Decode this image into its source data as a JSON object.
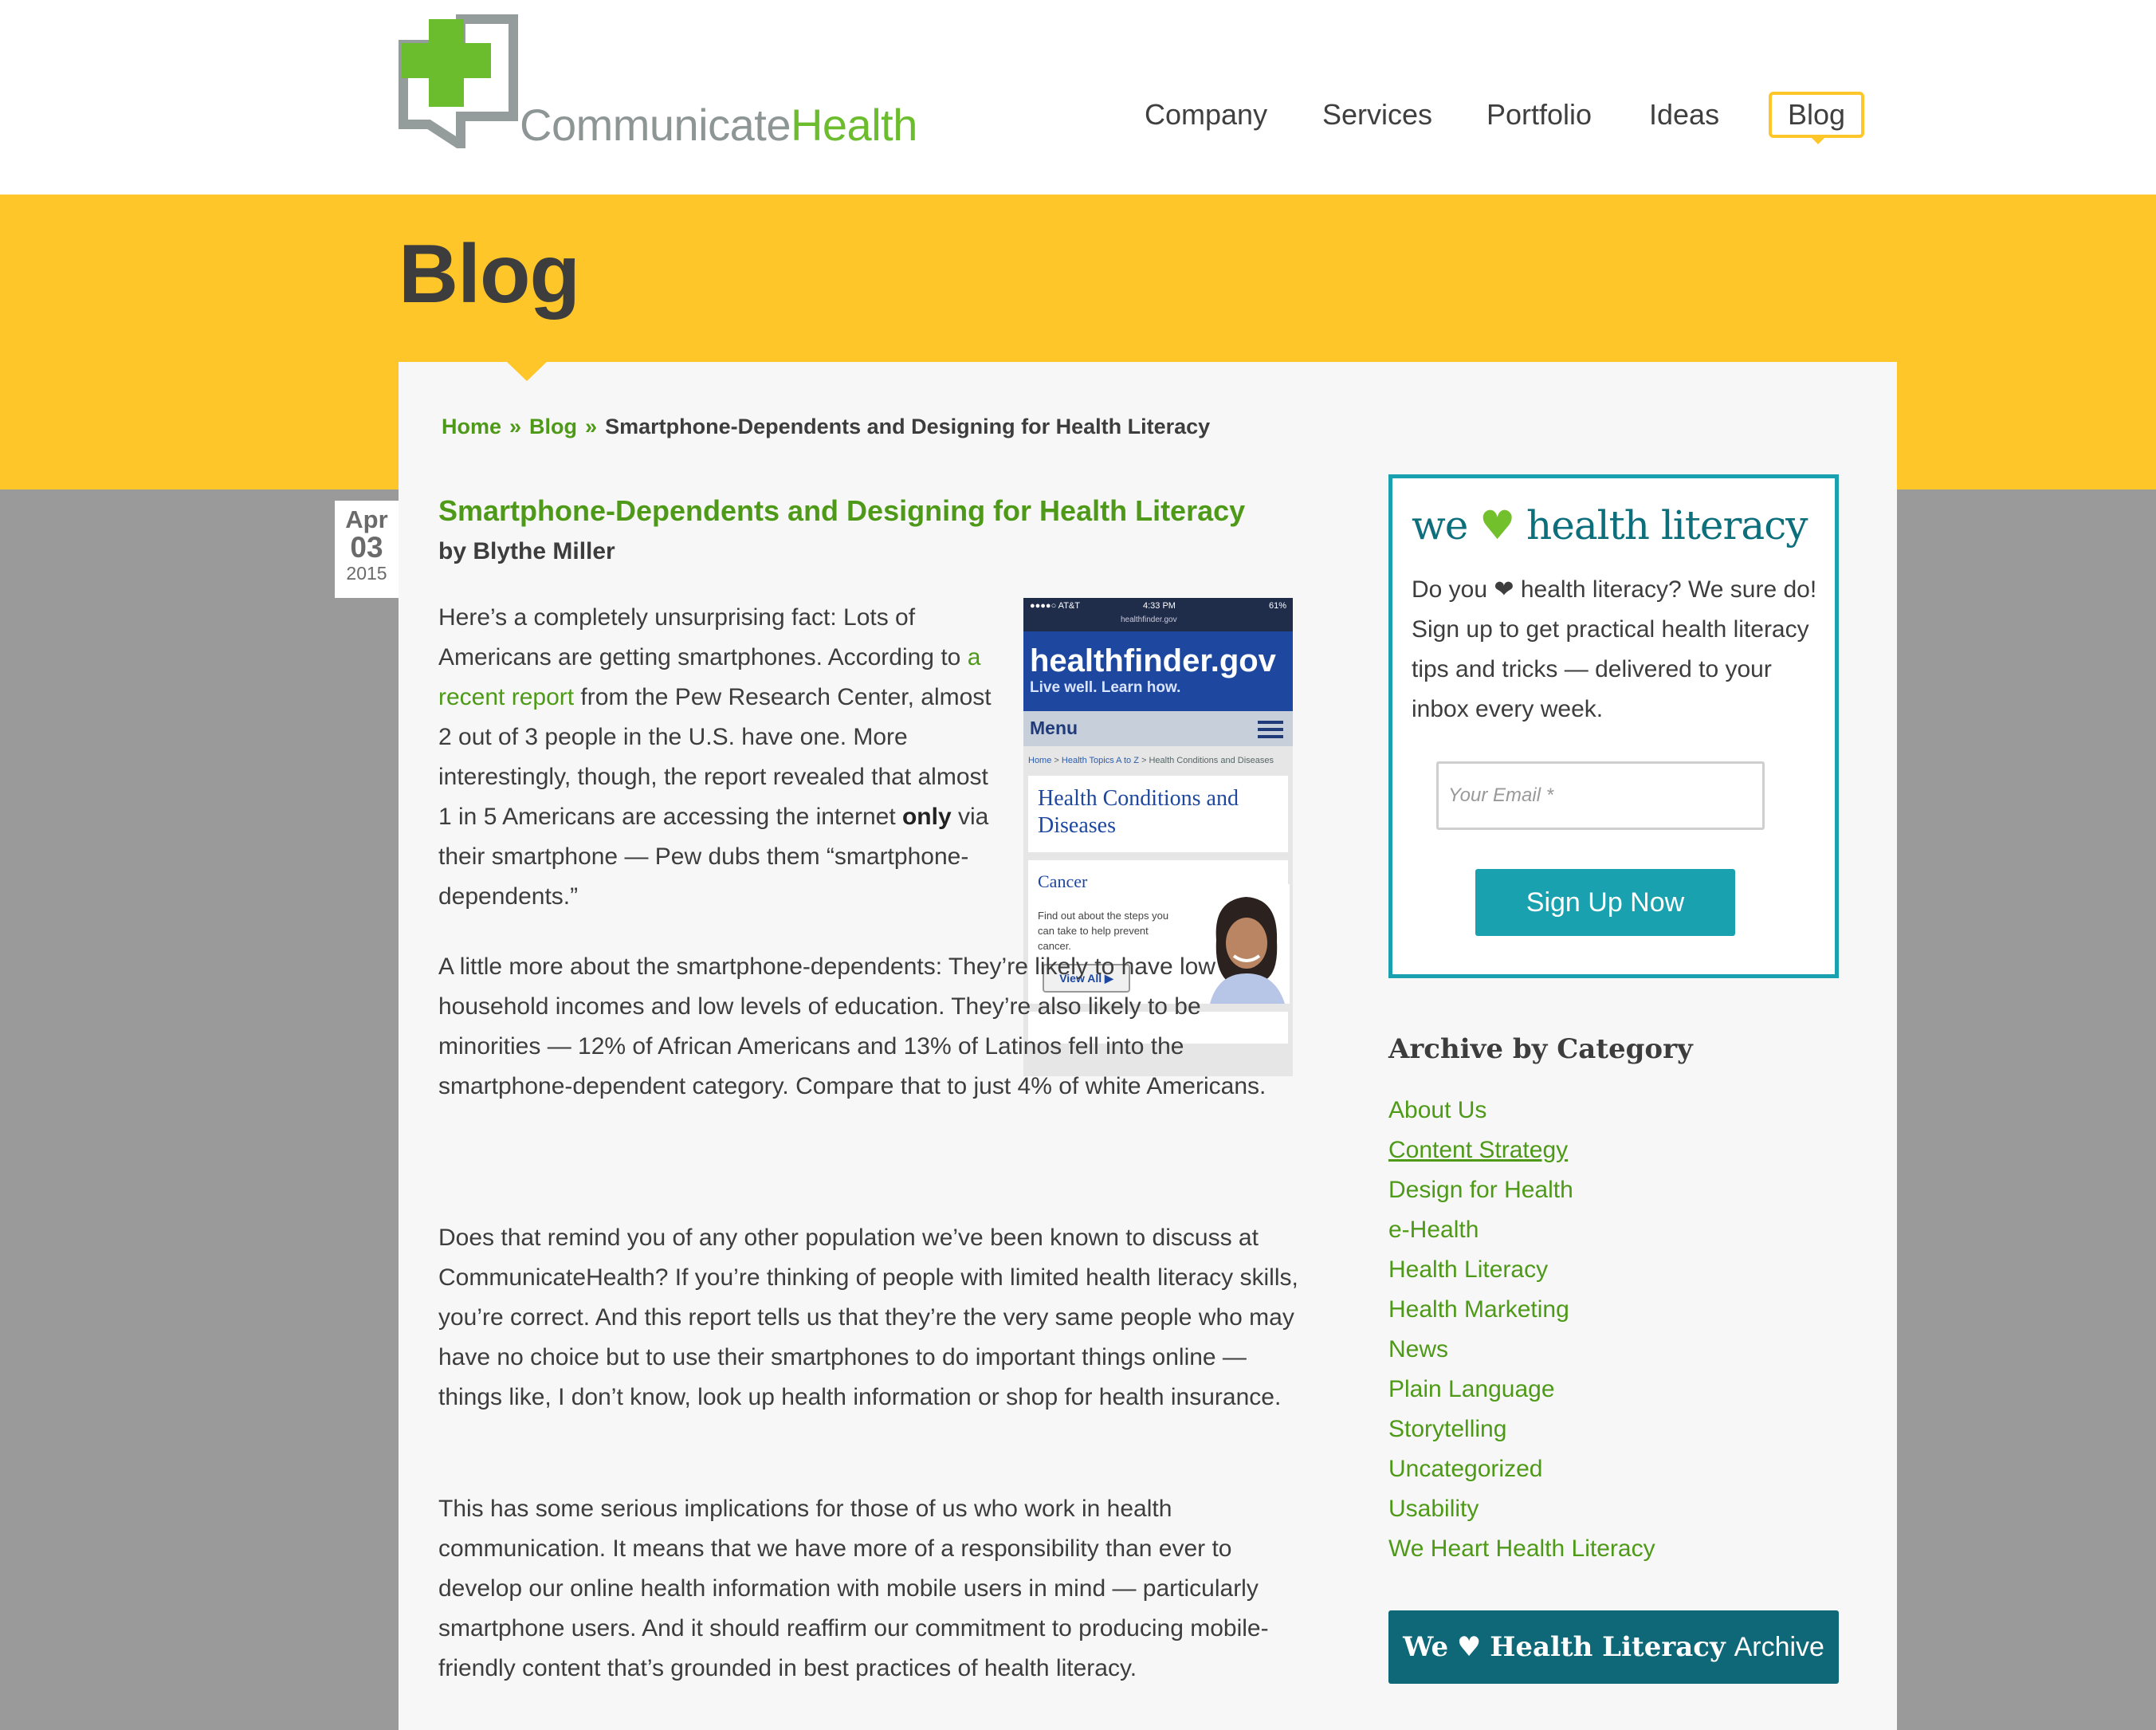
{
  "header": {
    "logo_word1": "Communicate",
    "logo_word2": "Health",
    "nav": [
      {
        "label": "Company"
      },
      {
        "label": "Services"
      },
      {
        "label": "Portfolio"
      },
      {
        "label": "Ideas"
      },
      {
        "label": "Blog",
        "active": true
      }
    ]
  },
  "page_title": "Blog",
  "breadcrumb": {
    "home": "Home",
    "sep": "»",
    "blog": "Blog",
    "current": "Smartphone-Dependents and Designing for Health Literacy"
  },
  "post": {
    "date": {
      "month": "Apr",
      "day": "03",
      "year": "2015"
    },
    "title": "Smartphone-Dependents and Designing for Health Literacy",
    "byline": "by Blythe Miller",
    "p1": {
      "before_link": "Here’s a completely unsurprising fact: Lots of Americans are getting smartphones. According to ",
      "link": "a recent report",
      "after_link": " from the Pew Research Center, almost 2 out of 3 people in the U.S. have one. More interestingly, though, the report revealed that almost 1 in 5 Americans are accessing the internet ",
      "bold": "only",
      "end": " via their smartphone — Pew dubs them “smartphone-dependents.”"
    },
    "p2": "A little more about the smartphone-dependents: They’re likely to have low household incomes and low levels of education. They’re also likely to be minorities — 12% of African Americans and 13% of Latinos fell into the smartphone-dependent category. Compare that to just 4% of white Americans.",
    "p3": "Does that remind you of any other population we’ve been known to discuss at CommunicateHealth? If you’re thinking of people with limited health literacy skills, you’re correct. And this report tells us that they’re the very same people who may have no choice but to use their smartphones to do important things online — things like, I don’t know, look up health information or shop for health insurance.",
    "p4": "This has some serious implications for those of us who work in health communication. It means that we have more of a responsibility than ever to develop our online health information with mobile users in mind — particularly smartphone users. And it should reaffirm our commitment to producing mobile-friendly content that’s grounded in best practices of health literacy."
  },
  "phone_screenshot": {
    "carrier": "●●●●○ AT&T ",
    "time": "4:33 PM",
    "url": "healthfinder.gov",
    "battery": "61%",
    "site_name": "healthfinder.gov",
    "tagline": "Live well. Learn how.",
    "menu": "Menu",
    "crumb_home": "Home",
    "crumb_topics": "Health Topics A to Z",
    "crumb_rest": " > Health Conditions and Diseases",
    "section_title": "Health Conditions and Diseases",
    "card_title": "Cancer",
    "card_text": "Find out about the steps you can take to help prevent cancer.",
    "card_button": "View All ▶"
  },
  "sidebar": {
    "signup": {
      "title_we": "we",
      "title_heart": "♥",
      "title_rest": "health literacy",
      "text": "Do you ❤ health literacy? We sure do! Sign up to get practical health literacy tips and tricks — delivered to your inbox every week.",
      "email_placeholder": "Your Email *",
      "button": "Sign Up Now"
    },
    "archive_title": "Archive by Category",
    "categories": [
      "About Us",
      "Content Strategy",
      "Design for Health",
      "e-Health",
      "Health Literacy",
      "Health Marketing",
      "News",
      "Plain Language",
      "Storytelling",
      "Uncategorized",
      "Usability",
      "We Heart Health Literacy"
    ],
    "archive_button": {
      "we": "We",
      "heart": "♥",
      "hl": "Health Literacy",
      "archive": "Archive"
    }
  },
  "colors": {
    "brand_green": "#6cbd2e",
    "link_green": "#4e9a18",
    "yellow": "#ffc629",
    "teal": "#1aa1b0",
    "dark_teal": "#0f6878",
    "gray_bg": "#9a9a9a"
  }
}
